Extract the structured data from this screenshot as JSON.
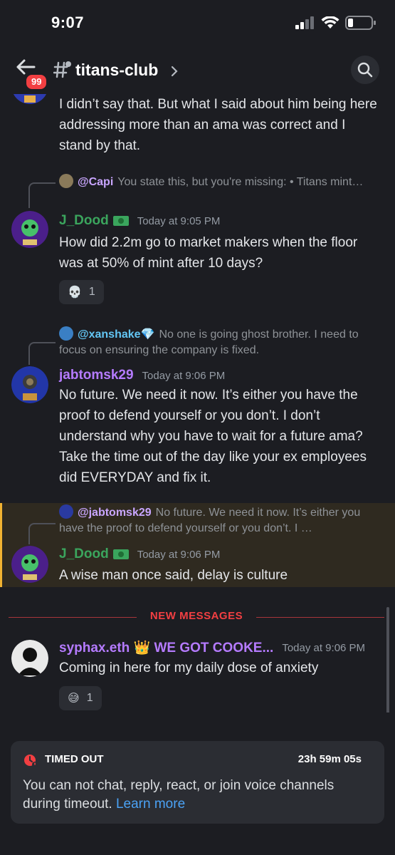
{
  "status_bar": {
    "time": "9:07",
    "icons": [
      "signal-icon",
      "wifi-icon",
      "battery-icon"
    ]
  },
  "header": {
    "unread_badge": "99",
    "channel_name": "titans-club",
    "icons": [
      "back-arrow-icon",
      "hashtag-thread-icon",
      "chevron-right-icon",
      "search-icon"
    ]
  },
  "messages": [
    {
      "text": "I didn’t say that. But what I said about him being here addressing more than an ama was correct and I stand by that."
    },
    {
      "reply": {
        "name": "@Capi",
        "text": "You state this, but you're missing: • Titans mint…"
      },
      "username": "J_Dood",
      "username_color": "#3ba55d",
      "timestamp": "Today at 9:05 PM",
      "text": "How did 2.2m go to market makers when the floor was at 50% of mint after 10 days?",
      "reaction": {
        "emoji": "💀",
        "count": "1"
      }
    },
    {
      "reply": {
        "name": "@xanshake💎",
        "text": "No one is going ghost brother. I need to focus on ensuring the company is fixed."
      },
      "username": "jabtomsk29",
      "username_color": "#b57bff",
      "timestamp": "Today at 9:06 PM",
      "text": "No future. We need it now. It’s either you have the proof to defend yourself or you don’t. I don’t understand why you have to wait for a future ama? Take the time out of the day like your ex employees did EVERYDAY  and fix it."
    },
    {
      "reply": {
        "name": "@jabtomsk29",
        "text": "No future. We need it now. It’s either you have the proof to defend yourself or you don’t. I …"
      },
      "username": "J_Dood",
      "username_color": "#3ba55d",
      "timestamp": "Today at 9:06 PM",
      "text": "A wise man once said, delay is culture"
    },
    {
      "username": "syphax.eth 👑 WE GOT COOKE...",
      "username_color": "#b57bff",
      "timestamp": "Today at 9:06 PM",
      "text": "Coming in here for my daily dose of anxiety",
      "reaction": {
        "emoji": "😅",
        "count": "1"
      }
    }
  ],
  "new_messages_label": "NEW MESSAGES",
  "timeout": {
    "title": "TIMED OUT",
    "remaining": "23h 59m 05s",
    "description": "You can not chat, reply, react, or join voice channels during timeout.",
    "link": "Learn more"
  }
}
